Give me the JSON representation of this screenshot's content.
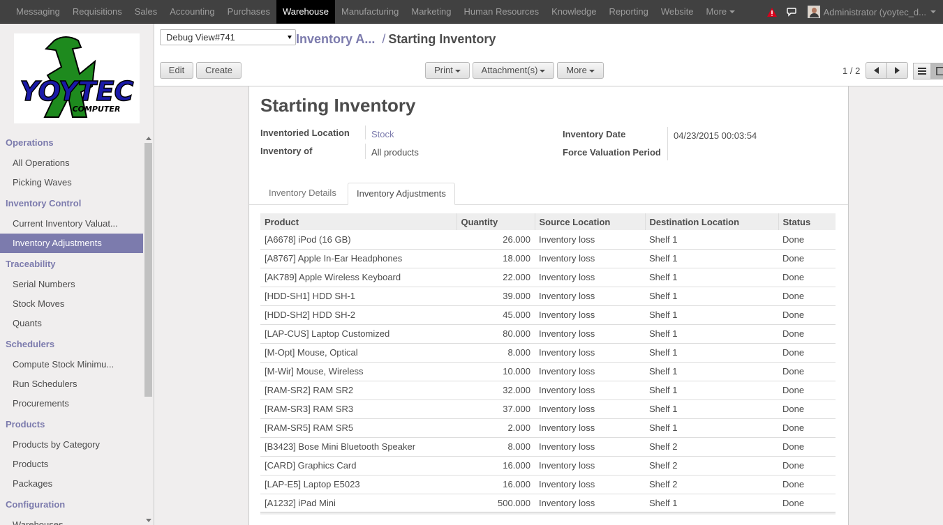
{
  "topbar": {
    "menu": [
      "Messaging",
      "Requisitions",
      "Sales",
      "Accounting",
      "Purchases",
      "Warehouse",
      "Manufacturing",
      "Marketing",
      "Human Resources",
      "Knowledge",
      "Reporting",
      "Website"
    ],
    "active": "Warehouse",
    "more_label": "More",
    "user_label": "Administrator (yoytec_d..."
  },
  "logo": {
    "text": "YOYTEC",
    "subtext": "COMPUTER"
  },
  "sidebar": {
    "sections": [
      {
        "title": "Operations",
        "items": [
          "All Operations",
          "Picking Waves"
        ]
      },
      {
        "title": "Inventory Control",
        "items": [
          "Current Inventory Valuat...",
          "Inventory Adjustments"
        ]
      },
      {
        "title": "Traceability",
        "items": [
          "Serial Numbers",
          "Stock Moves",
          "Quants"
        ]
      },
      {
        "title": "Schedulers",
        "items": [
          "Compute Stock Minimu...",
          "Run Schedulers",
          "Procurements"
        ]
      },
      {
        "title": "Products",
        "items": [
          "Products by Category",
          "Products",
          "Packages"
        ]
      },
      {
        "title": "Configuration",
        "items": [
          "Warehouses"
        ]
      }
    ],
    "active_item": "Inventory Adjustments"
  },
  "control_panel": {
    "debug_select": "Debug View#741",
    "breadcrumb_parent": "Inventory A...",
    "breadcrumb_sep": "/",
    "breadcrumb_current": "Starting Inventory",
    "edit_label": "Edit",
    "create_label": "Create",
    "print_label": "Print",
    "attachments_label": "Attachment(s)",
    "more_label": "More",
    "pager": "1 / 2"
  },
  "form": {
    "title": "Starting Inventory",
    "inventoried_location_label": "Inventoried Location",
    "inventoried_location_value": "Stock",
    "inventory_of_label": "Inventory of",
    "inventory_of_value": "All products",
    "inventory_date_label": "Inventory Date",
    "inventory_date_value": "04/23/2015 00:03:54",
    "force_valuation_label": "Force Valuation Period",
    "tabs": [
      "Inventory Details",
      "Inventory Adjustments"
    ],
    "active_tab": "Inventory Adjustments"
  },
  "table": {
    "columns": [
      "Product",
      "Quantity",
      "Source Location",
      "Destination Location",
      "Status"
    ],
    "rows": [
      [
        "[A6678] iPod (16 GB)",
        "26.000",
        "Inventory loss",
        "Shelf 1",
        "Done"
      ],
      [
        "[A8767] Apple In-Ear Headphones",
        "18.000",
        "Inventory loss",
        "Shelf 1",
        "Done"
      ],
      [
        "[AK789] Apple Wireless Keyboard",
        "22.000",
        "Inventory loss",
        "Shelf 1",
        "Done"
      ],
      [
        "[HDD-SH1] HDD SH-1",
        "39.000",
        "Inventory loss",
        "Shelf 1",
        "Done"
      ],
      [
        "[HDD-SH2] HDD SH-2",
        "45.000",
        "Inventory loss",
        "Shelf 1",
        "Done"
      ],
      [
        "[LAP-CUS] Laptop Customized",
        "80.000",
        "Inventory loss",
        "Shelf 1",
        "Done"
      ],
      [
        "[M-Opt] Mouse, Optical",
        "8.000",
        "Inventory loss",
        "Shelf 1",
        "Done"
      ],
      [
        "[M-Wir] Mouse, Wireless",
        "10.000",
        "Inventory loss",
        "Shelf 1",
        "Done"
      ],
      [
        "[RAM-SR2] RAM SR2",
        "32.000",
        "Inventory loss",
        "Shelf 1",
        "Done"
      ],
      [
        "[RAM-SR3] RAM SR3",
        "37.000",
        "Inventory loss",
        "Shelf 1",
        "Done"
      ],
      [
        "[RAM-SR5] RAM SR5",
        "2.000",
        "Inventory loss",
        "Shelf 1",
        "Done"
      ],
      [
        "[B3423] Bose Mini Bluetooth Speaker",
        "8.000",
        "Inventory loss",
        "Shelf 2",
        "Done"
      ],
      [
        "[CARD] Graphics Card",
        "16.000",
        "Inventory loss",
        "Shelf 2",
        "Done"
      ],
      [
        "[LAP-E5] Laptop E5023",
        "16.000",
        "Inventory loss",
        "Shelf 2",
        "Done"
      ],
      [
        "[A1232] iPad Mini",
        "500.000",
        "Inventory loss",
        "Shelf 1",
        "Done"
      ]
    ]
  },
  "colors": {
    "accent": "#7c7bad",
    "navbar": "#414141",
    "warning": "#d9001b"
  }
}
